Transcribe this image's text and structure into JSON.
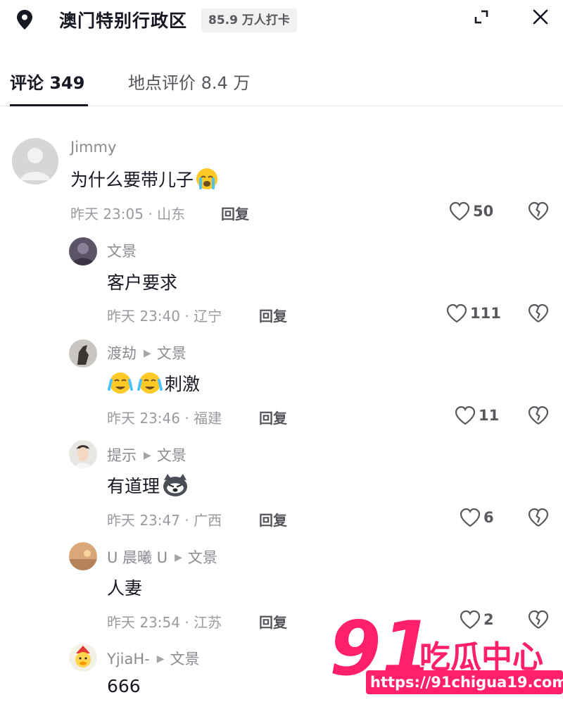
{
  "header": {
    "location_icon": "location-pin-icon",
    "place": "澳门特别行政区",
    "checkin_badge": "85.9 万人打卡",
    "expand_icon": "expand-icon",
    "close_icon": "close-icon"
  },
  "tabs": [
    {
      "label": "评论 349",
      "active": true
    },
    {
      "label": "地点评价 8.4 万",
      "active": false
    }
  ],
  "comments": [
    {
      "user": "Jimmy",
      "reply_to": "",
      "text": "为什么要带儿子",
      "emoji_after": [
        "crying-face-emoji"
      ],
      "time": "昨天 23:05 · 山东",
      "reply_label": "回复",
      "likes": "50"
    },
    {
      "user": "文景",
      "reply_to": "",
      "text": "客户要求",
      "emoji_after": [],
      "time": "昨天 23:40 · 辽宁",
      "reply_label": "回复",
      "likes": "111"
    },
    {
      "user": "渡劫",
      "reply_to": "文景",
      "text": "刺激",
      "emoji_before": [
        "crying-face-emoji",
        "crying-face-emoji"
      ],
      "time": "昨天 23:46 · 福建",
      "reply_label": "回复",
      "likes": "11"
    },
    {
      "user": "提示",
      "reply_to": "文景",
      "text": "有道理",
      "emoji_after": [
        "husky-dog-emoji"
      ],
      "time": "昨天 23:47 · 广西",
      "reply_label": "回复",
      "likes": "6"
    },
    {
      "user": "U 晨曦 U",
      "reply_to": "文景",
      "text": "人妻",
      "emoji_after": [],
      "time": "昨天 23:54 · 江苏",
      "reply_label": "回复",
      "likes": "2"
    },
    {
      "user": "YjiaH-",
      "reply_to": "文景",
      "text": "666",
      "emoji_after": [],
      "time": "",
      "reply_label": "",
      "likes": ""
    }
  ],
  "watermark": {
    "number": "91",
    "name": "吃瓜中心",
    "url": "https://91chigua19.com"
  },
  "colors": {
    "text_primary": "#161823",
    "text_secondary": "#8a8b91",
    "watermark_pink": "#ff1f6a"
  }
}
